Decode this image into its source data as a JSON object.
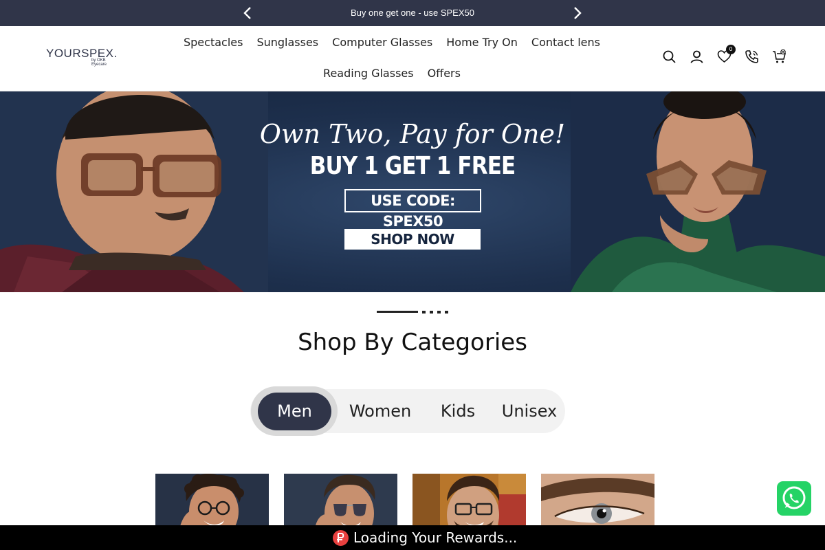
{
  "announcement": {
    "text": "Buy one get one - use SPEX50",
    "prev_icon": "chevron-left-icon",
    "next_icon": "chevron-right-icon"
  },
  "brand": {
    "logo_text": "YOURSPEX.",
    "logo_subtext": "by OKB Eyecare"
  },
  "nav": {
    "row1": [
      "Spectacles",
      "Sunglasses",
      "Computer Glasses",
      "Home Try On",
      "Contact lens"
    ],
    "row2": [
      "Reading Glasses",
      "Offers"
    ]
  },
  "header_icons": {
    "search": "search-icon",
    "account": "user-icon",
    "wishlist": "heart-icon",
    "wishlist_count": "0",
    "phone": "phone-icon",
    "cart": "cart-icon"
  },
  "banner": {
    "tagline": "Own Two, Pay for One!",
    "headline": "BUY 1 GET 1 FREE",
    "code": "USE CODE: SPEX50",
    "cta": "SHOP NOW"
  },
  "categories": {
    "title": "Shop By Categories",
    "tabs": [
      "Men",
      "Women",
      "Kids",
      "Unisex"
    ],
    "active_tab": "Men"
  },
  "tiles": [
    "men-curly-hair-round-glasses",
    "men-aviator-sunglasses",
    "men-smiling-rectangle-glasses",
    "eye-closeup-contact-lens"
  ],
  "rewards": {
    "text": "Loading Your Rewards..."
  },
  "colors": {
    "navy": "#303549",
    "banner_blue": "#1d2f4c",
    "whatsapp_green": "#25d366",
    "rewards_red": "#e9403f"
  }
}
